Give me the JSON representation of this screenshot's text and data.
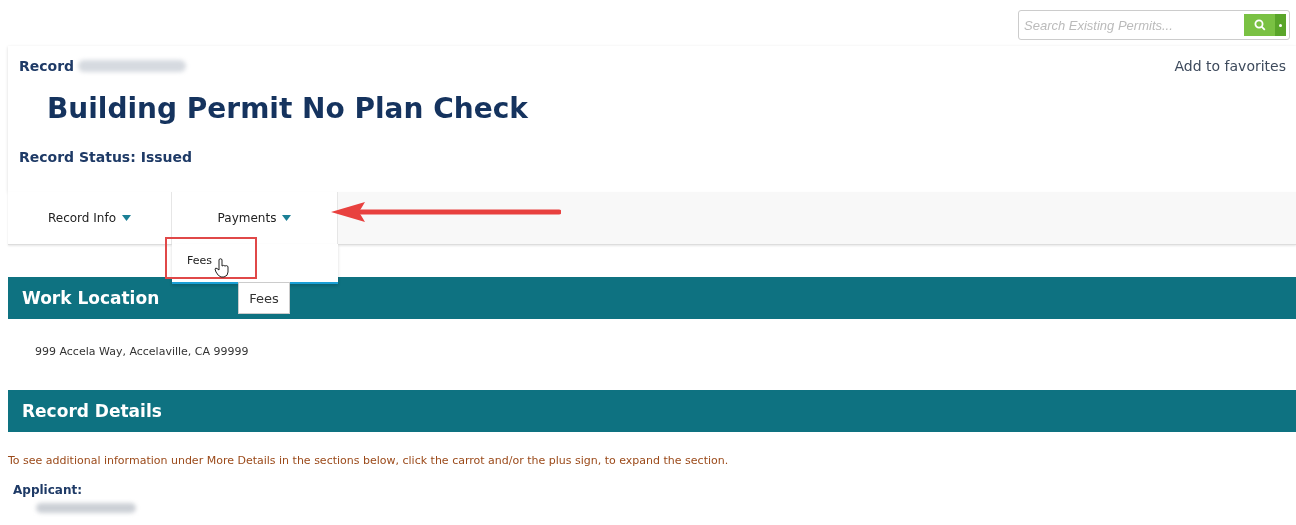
{
  "search": {
    "placeholder": "Search Existing Permits..."
  },
  "record": {
    "label": "Record",
    "add_favorites": "Add to favorites",
    "title": "Building Permit No Plan Check",
    "status": "Record Status: Issued"
  },
  "tabs": [
    {
      "label": "Record Info",
      "expanded": false
    },
    {
      "label": "Payments",
      "expanded": true,
      "items": [
        {
          "label": "Fees",
          "highlighted": true
        }
      ]
    }
  ],
  "annotation": {
    "kind": "arrow"
  },
  "tooltip": "Fees",
  "sections": [
    {
      "title": "Work Location",
      "lines": [
        {
          "kind": "text",
          "text": "999 Accela Way, Accelaville, CA 99999"
        }
      ]
    },
    {
      "title": "Record Details",
      "lines": [
        {
          "kind": "note",
          "text": "To see additional information under More Details in the sections below, click the carrot and/or the plus sign, to expand the section."
        },
        {
          "kind": "label",
          "text": "Applicant:"
        },
        {
          "kind": "blurred"
        }
      ]
    }
  ]
}
